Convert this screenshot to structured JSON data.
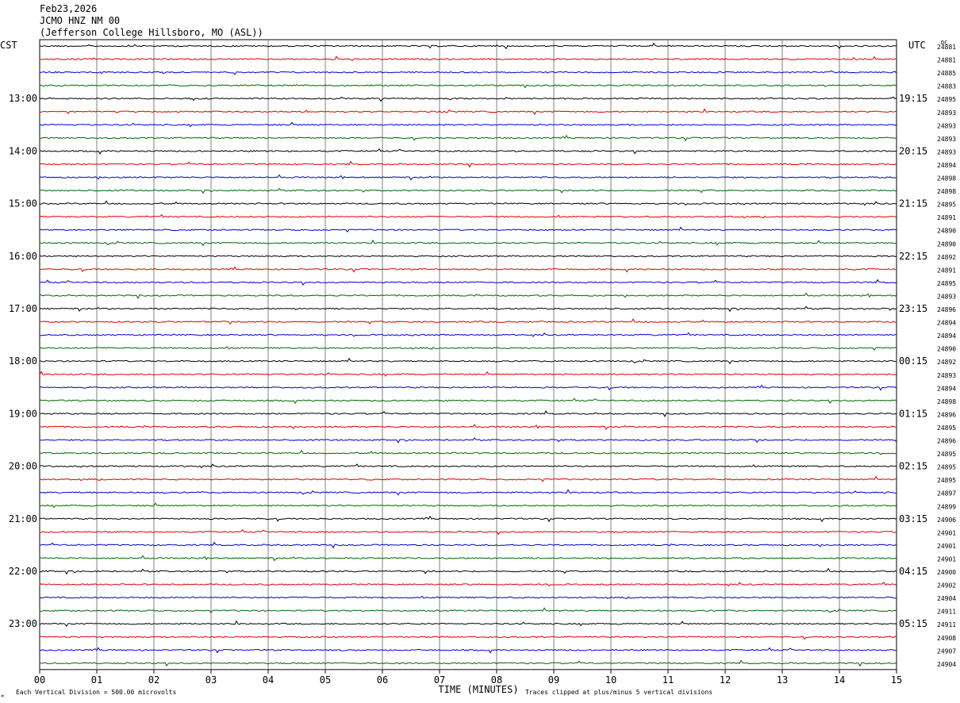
{
  "header": {
    "date": "Feb23,2026",
    "station": "JCMO HNZ NM 00",
    "location": "(Jefferson College Hillsboro, MO (ASL))"
  },
  "left_tz": "CST",
  "right_tz": "UTC",
  "dc_label": "DC",
  "footer": {
    "scale": "Each Vertical Division =  500.00 microvolts",
    "clip": "Traces clipped at plus/minus 5 vertical divisions",
    "corner_mark": "≈"
  },
  "colors": {
    "trace_cycle": [
      "#000000",
      "#dd0000",
      "#0000cc",
      "#006600"
    ],
    "grid": "#7f7f7f"
  },
  "chart_data": {
    "type": "line",
    "title": "JCMO HNZ NM 00",
    "xlabel": "TIME (MINUTES)",
    "ylabel": "",
    "x_ticks": [
      "00",
      "01",
      "02",
      "03",
      "04",
      "05",
      "06",
      "07",
      "08",
      "09",
      "10",
      "11",
      "12",
      "13",
      "14",
      "15"
    ],
    "xlim": [
      0,
      15
    ],
    "left_hour_labels": [
      "13:00",
      "14:00",
      "15:00",
      "16:00",
      "17:00",
      "18:00",
      "19:00",
      "20:00",
      "21:00",
      "22:00",
      "23:00"
    ],
    "right_hour_labels": [
      "19:15",
      "20:15",
      "21:15",
      "22:15",
      "23:15",
      "00:15",
      "01:15",
      "02:15",
      "03:15",
      "04:15",
      "05:15"
    ],
    "dc_offsets": [
      "24881",
      "24881",
      "24885",
      "24883",
      "24895",
      "24893",
      "24893",
      "24893",
      "24893",
      "24894",
      "24898",
      "24898",
      "24895",
      "24891",
      "24890",
      "24890",
      "24892",
      "24891",
      "24895",
      "24893",
      "24896",
      "24894",
      "24894",
      "24890",
      "24892",
      "24893",
      "24894",
      "24898",
      "24896",
      "24895",
      "24896",
      "24895",
      "24895",
      "24895",
      "24897",
      "24899",
      "24906",
      "24901",
      "24901",
      "24901",
      "24900",
      "24902",
      "24904",
      "24911",
      "24911",
      "24908",
      "24907",
      "24904"
    ],
    "rows": 48,
    "grid": true
  }
}
